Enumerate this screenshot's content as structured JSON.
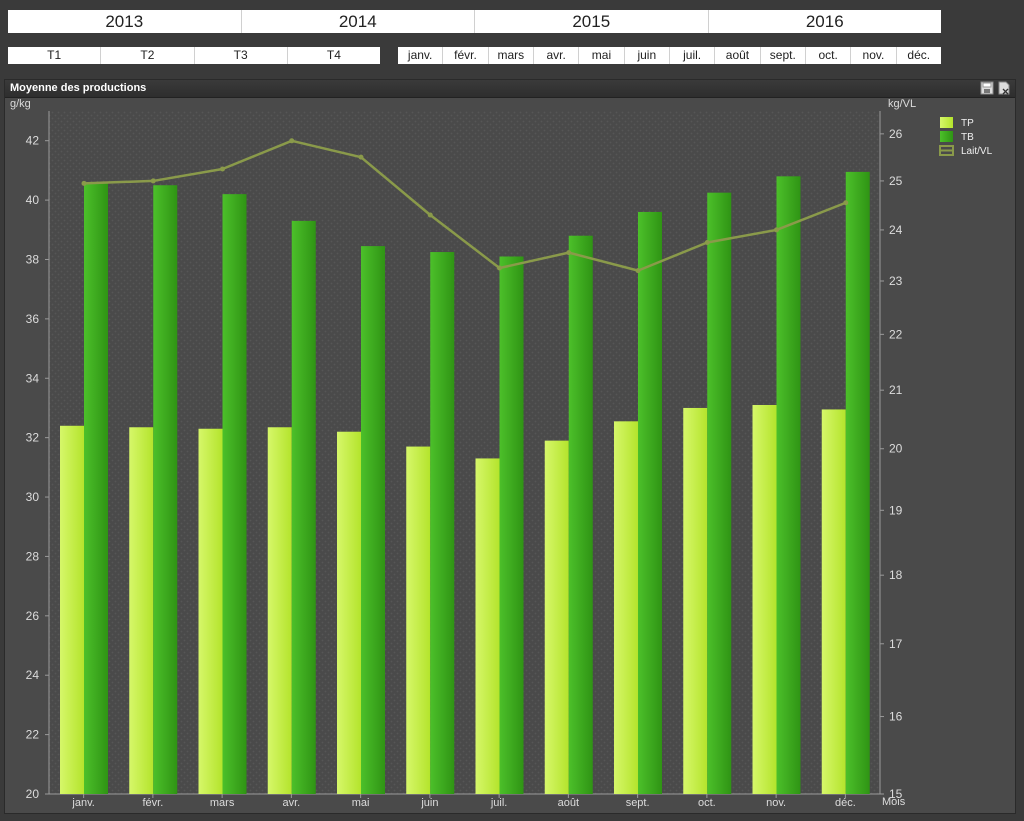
{
  "filters": {
    "years": [
      "2013",
      "2014",
      "2015",
      "2016"
    ],
    "quarters": [
      "T1",
      "T2",
      "T3",
      "T4"
    ],
    "months": [
      "janv.",
      "févr.",
      "mars",
      "avr.",
      "mai",
      "juin",
      "juil.",
      "août",
      "sept.",
      "oct.",
      "nov.",
      "déc."
    ]
  },
  "panel": {
    "title": "Moyenne des productions",
    "tools": [
      "save-icon",
      "export-icon"
    ]
  },
  "chart_data": {
    "type": "bar",
    "title": "",
    "xlabel": "Mois",
    "ylabel_left": "g/kg",
    "ylabel_right": "kg/VL",
    "categories": [
      "janv.",
      "févr.",
      "mars",
      "avr.",
      "mai",
      "juin",
      "juil.",
      "août",
      "sept.",
      "oct.",
      "nov.",
      "déc."
    ],
    "ylim_left": [
      20,
      43
    ],
    "yticks_left": [
      20,
      22,
      24,
      26,
      28,
      30,
      32,
      34,
      36,
      38,
      40,
      42
    ],
    "ylim_right": [
      15,
      26.5
    ],
    "yticks_right": [
      15,
      16,
      17,
      18,
      19,
      20,
      21,
      22,
      23,
      24,
      25,
      26
    ],
    "right_axis_scale": "log",
    "grid": false,
    "legend_position": "top-right",
    "series": [
      {
        "name": "TP",
        "type": "bar",
        "axis": "left",
        "color": "#c8f040",
        "values": [
          32.4,
          32.35,
          32.3,
          32.35,
          32.2,
          31.7,
          31.3,
          31.9,
          32.55,
          33.0,
          33.1,
          32.95
        ]
      },
      {
        "name": "TB",
        "type": "bar",
        "axis": "left",
        "color": "#3aa81c",
        "values": [
          40.6,
          40.5,
          40.2,
          39.3,
          38.45,
          38.25,
          38.1,
          38.8,
          39.6,
          40.25,
          40.8,
          40.95
        ]
      },
      {
        "name": "Lait/VL",
        "type": "line",
        "axis": "right",
        "color": "#8a9a4a",
        "values": [
          24.95,
          25.0,
          25.25,
          25.85,
          25.5,
          24.3,
          23.25,
          23.55,
          23.2,
          23.75,
          24.0,
          24.55
        ]
      }
    ]
  }
}
